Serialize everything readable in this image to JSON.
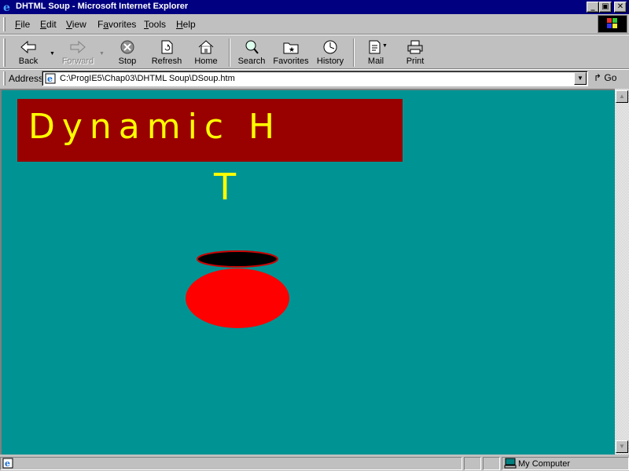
{
  "window": {
    "title": "DHTML Soup - Microsoft Internet Explorer"
  },
  "caption_buttons": {
    "minimize": "_",
    "maximize": "▣",
    "close": "✕"
  },
  "menu": [
    {
      "label": "File",
      "hotkey": "F",
      "rest": "ile"
    },
    {
      "label": "Edit",
      "hotkey": "E",
      "rest": "dit"
    },
    {
      "label": "View",
      "hotkey": "V",
      "rest": "iew"
    },
    {
      "label": "Favorites",
      "hotkey": "",
      "rest": "Favorites",
      "prefix": "F",
      "u": "a",
      "suffix": "vorites"
    },
    {
      "label": "Tools",
      "hotkey": "T",
      "rest": "ools"
    },
    {
      "label": "Help",
      "hotkey": "H",
      "rest": "elp"
    }
  ],
  "toolbar": {
    "back": "Back",
    "forward": "Forward",
    "stop": "Stop",
    "refresh": "Refresh",
    "home": "Home",
    "search": "Search",
    "favorites": "Favorites",
    "history": "History",
    "mail": "Mail",
    "print": "Print"
  },
  "address": {
    "label": "Address",
    "value": "C:\\ProgIE5\\Chap03\\DHTML Soup\\DSoup.htm",
    "go": "Go"
  },
  "content": {
    "banner_text": "Dynamic H",
    "falling_letter": "T"
  },
  "colors": {
    "page_bg": "#009393",
    "banner_bg": "#990000",
    "letter_color": "#ffff00",
    "pot_color": "#ff0000",
    "titlebar": "#000080"
  },
  "status": {
    "zone": "My Computer"
  }
}
